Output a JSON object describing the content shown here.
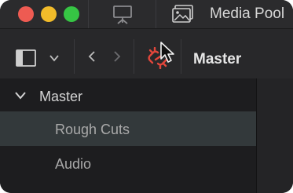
{
  "app": {
    "panel_title": "Media Pool"
  },
  "toolbar": {
    "current_bin": "Master"
  },
  "bins": {
    "root": {
      "label": "Master",
      "expanded": true
    },
    "children": [
      {
        "label": "Rough Cuts",
        "selected": true
      },
      {
        "label": "Audio",
        "selected": false
      }
    ]
  },
  "colors": {
    "close": "#ee5b52",
    "minimize": "#f1bb2a",
    "maximize": "#36c544",
    "unlink_accent": "#e2463b",
    "selected_row": "#33393b"
  },
  "icons": {
    "present": "present-screen-icon",
    "media_pool": "media-pool-icon",
    "sidebar_toggle": "sidebar-toggle-icon",
    "unlink": "unlink-icon",
    "cursor": "cursor-icon"
  }
}
